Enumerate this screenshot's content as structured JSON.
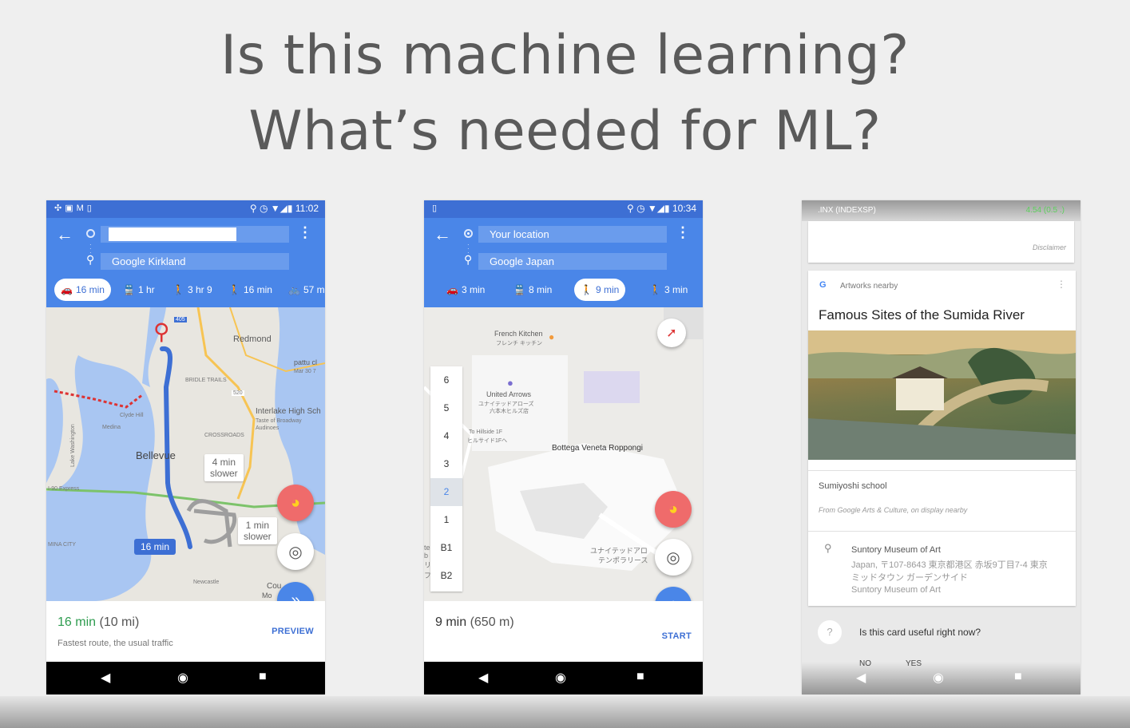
{
  "slide": {
    "title_line1": "Is this machine learning?",
    "title_line2": "What’s needed for ML?"
  },
  "phone1": {
    "status_time": "11:02",
    "origin_value": "",
    "destination": "Google Kirkland",
    "modes": [
      {
        "icon": "car-icon",
        "glyph": "🚗",
        "label": "16 min",
        "active": true
      },
      {
        "icon": "transit-icon",
        "glyph": "🚆",
        "label": "1 hr",
        "active": false
      },
      {
        "icon": "walk-icon",
        "glyph": "🚶",
        "label": "3 hr 9",
        "active": false
      },
      {
        "icon": "ride-icon",
        "glyph": "🚶",
        "label": "16 min",
        "active": false
      },
      {
        "icon": "bike-icon",
        "glyph": "🚲",
        "label": "57 m",
        "active": false
      }
    ],
    "map_labels": {
      "redmond": "Redmond",
      "bellevue": "Bellevue",
      "clyde_hill": "Clyde Hill",
      "medina": "Medina",
      "lake_washington": "Lake Washington",
      "interlake": "Interlake High Sch",
      "interlake_sub1": "Taste of Broadway",
      "interlake_sub2": "Audinoes",
      "pattu": "pattu cl",
      "pattu_sub": "Mar 30 7",
      "newcastle": "Newcastle",
      "bridle_trails": "BRIDLE TRAILS",
      "crossroads": "CROSSROADS",
      "express": "I-90 Express",
      "mina_city": "MINA CITY",
      "cou": "Cou",
      "mo": "Mo",
      "hwy_405": "405",
      "hwy_520": "520"
    },
    "callout_4min_l1": "4 min",
    "callout_4min_l2": "slower",
    "callout_1min_l1": "1 min",
    "callout_1min_l2": "slower",
    "route_badge": "16 min",
    "eta_time": "16 min",
    "eta_dist": "(10 mi)",
    "eta_sub": "Fastest route, the usual traffic",
    "action": "PREVIEW"
  },
  "phone2": {
    "status_time": "10:34",
    "origin": "Your location",
    "destination": "Google Japan",
    "modes": [
      {
        "icon": "car-icon",
        "glyph": "🚗",
        "label": "3 min",
        "active": false
      },
      {
        "icon": "transit-icon",
        "glyph": "🚆",
        "label": "8 min",
        "active": false
      },
      {
        "icon": "walk-icon",
        "glyph": "🚶",
        "label": "9 min",
        "active": true
      },
      {
        "icon": "ride-icon",
        "glyph": "🚶",
        "label": "3 min",
        "active": false
      }
    ],
    "floors": [
      "6",
      "5",
      "4",
      "3",
      "2",
      "1",
      "B1",
      "B2"
    ],
    "selected_floor": "2",
    "map_labels": {
      "french_kitchen": "French Kitchen",
      "french_kitchen_jp": "フレンチ キッチン",
      "united_arrows": "United Arrows",
      "united_arrows_jp1": "ユナイテッドアローズ",
      "united_arrows_jp2": "六本木ヒルズ店",
      "hillside": "To Hillside 1F",
      "hillside_jp": "ヒルサイド1Fへ",
      "bottega": "Bottega Veneta Roppongi",
      "united_temp_jp1": "ユナイテッドアロ",
      "united_temp_jp2": "テンポラリース",
      "edge_left": "te b リ フ"
    },
    "eta_time": "9 min",
    "eta_dist": "(650 m)",
    "action": "START"
  },
  "phone3": {
    "top_bar_left": ".INX (INDEXSP)",
    "top_bar_right": "4.54 (0.5 .)",
    "disclaimer": "Disclaimer",
    "card_label": "Artworks nearby",
    "card_title": "Famous Sites of the Sumida River",
    "school": "Sumiyoshi school",
    "source": "From Google Arts & Culture, on display nearby",
    "museum_name": "Suntory Museum of Art",
    "museum_addr1": "Japan, 〒107-8643 東京都港区 赤坂9丁目7-4 東京",
    "museum_addr2": "ミッドタウン ガーデンサイド",
    "museum_addr3": "Suntory Museum of Art",
    "feedback_question": "Is this card useful right now?",
    "feedback_no": "NO",
    "feedback_yes": "YES"
  },
  "colors": {
    "maps_blue": "#4a86e8",
    "status_blue": "#3d6fd4",
    "eta_green": "#2e9c4f",
    "pac_red": "#ef6b6b"
  }
}
